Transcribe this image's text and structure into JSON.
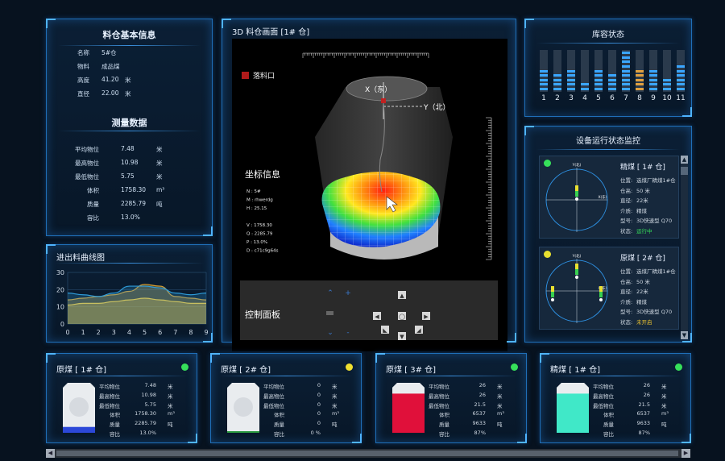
{
  "info": {
    "title": "料仓基本信息",
    "rows": [
      {
        "k": "名称",
        "v": "5#仓",
        "u": ""
      },
      {
        "k": "物料",
        "v": "成品煤",
        "u": ""
      },
      {
        "k": "高度",
        "v": "41.20",
        "u": "米"
      },
      {
        "k": "直径",
        "v": "22.00",
        "u": "米"
      }
    ],
    "measure_title": "测量数据",
    "measure": [
      {
        "k": "平均物位",
        "v": "7.48",
        "u": "米"
      },
      {
        "k": "最高物位",
        "v": "10.98",
        "u": "米"
      },
      {
        "k": "最低物位",
        "v": "5.75",
        "u": "米"
      },
      {
        "k": "体积",
        "v": "1758.30",
        "u": "m³"
      },
      {
        "k": "质量",
        "v": "2285.79",
        "u": "吨"
      },
      {
        "k": "容比",
        "v": "13.0%",
        "u": ""
      }
    ]
  },
  "curve": {
    "title": "进出料曲线图",
    "chart_data": {
      "type": "area",
      "x": [
        0,
        1,
        2,
        3,
        4,
        5,
        6,
        7,
        8,
        9
      ],
      "series": [
        {
          "values": [
            14,
            15,
            16,
            17,
            19,
            23,
            22,
            16,
            15,
            14
          ],
          "color": "#d8a032"
        },
        {
          "values": [
            18,
            17,
            16,
            18,
            22,
            22,
            21,
            18,
            17,
            18
          ],
          "color": "#2e9bd8"
        },
        {
          "values": [
            11,
            12,
            12,
            13,
            14,
            15,
            14,
            13,
            12,
            12
          ],
          "color": "#c8c060"
        }
      ],
      "xlabel": "",
      "ylabel": "",
      "ylim": [
        0,
        30
      ],
      "yticks": [
        "30",
        "20",
        "10",
        "0"
      ],
      "xticks": [
        "0",
        "1",
        "2",
        "3",
        "4",
        "5",
        "6",
        "7",
        "8",
        "9"
      ]
    }
  },
  "view3d": {
    "title": "3D 料仓画面 [1# 仓]",
    "legend": "落料口",
    "axis_x": "X（东）",
    "axis_y": "Y（北）",
    "coord_title": "坐标信息",
    "coord_lines": [
      "N : 5#",
      "M : rhwerdg",
      "H : 25.15",
      "",
      "V : 1758.30",
      "Q : 2285.79",
      "P : 13.0%",
      "D : c71c9g64s"
    ],
    "control_title": "控制面板"
  },
  "capacity": {
    "title": "库容状态",
    "bins": [
      {
        "label": "1",
        "fill": 0.5,
        "color": "#3aa6ff"
      },
      {
        "label": "2",
        "fill": 0.4,
        "color": "#3aa6ff"
      },
      {
        "label": "3",
        "fill": 0.55,
        "color": "#3aa6ff"
      },
      {
        "label": "4",
        "fill": 0.2,
        "color": "#3aa6ff"
      },
      {
        "label": "5",
        "fill": 0.5,
        "color": "#3aa6ff"
      },
      {
        "label": "6",
        "fill": 0.45,
        "color": "#3aa6ff"
      },
      {
        "label": "7",
        "fill": 0.95,
        "color": "#3aa6ff"
      },
      {
        "label": "8",
        "fill": 0.6,
        "color": "#e0a040"
      },
      {
        "label": "9",
        "fill": 0.6,
        "color": "#3aa6ff"
      },
      {
        "label": "10",
        "fill": 0.35,
        "color": "#3aa6ff"
      },
      {
        "label": "11",
        "fill": 0.7,
        "color": "#3aa6ff"
      }
    ]
  },
  "monitor": {
    "title": "设备运行状态监控",
    "cards": [
      {
        "name": "精煤 [ 1# 仓]",
        "dot": "#36e05a",
        "y_label": "Y(北)",
        "x_label": "X(东)",
        "rows": [
          {
            "k": "位置:",
            "v": "选煤厂精煤1#仓"
          },
          {
            "k": "仓高:",
            "v": "50 米"
          },
          {
            "k": "直径:",
            "v": "22米"
          },
          {
            "k": "介质:",
            "v": "精煤"
          },
          {
            "k": "型号:",
            "v": "3D快速型 Q70"
          },
          {
            "k": "状态:",
            "v": "运行中"
          }
        ],
        "status_color": "#36e05a"
      },
      {
        "name": "原煤 [ 2# 仓]",
        "dot": "#e8e030",
        "y_label": "Y(北)",
        "x_label": "X(东)",
        "rows": [
          {
            "k": "位置:",
            "v": "选煤厂精煤1#仓"
          },
          {
            "k": "仓高:",
            "v": "50 米"
          },
          {
            "k": "直径:",
            "v": "22米"
          },
          {
            "k": "介质:",
            "v": "精煤"
          },
          {
            "k": "型号:",
            "v": "3D快速型 Q70"
          },
          {
            "k": "状态:",
            "v": "未开启"
          }
        ],
        "status_color": "#e8c030"
      }
    ]
  },
  "silos": [
    {
      "title": "原煤 [ 1# 仓]",
      "dot": "#36e05a",
      "fill": 0.13,
      "fill_color": "#2c48d8",
      "rows": [
        {
          "k": "平均物位",
          "v": "7.48",
          "u": "米"
        },
        {
          "k": "最高物位",
          "v": "10.98",
          "u": "米"
        },
        {
          "k": "最低物位",
          "v": "5.75",
          "u": "米"
        },
        {
          "k": "体积",
          "v": "1758.30",
          "u": "m³"
        },
        {
          "k": "质量",
          "v": "2285.79",
          "u": "吨"
        },
        {
          "k": "容比",
          "v": "13.0%",
          "u": ""
        }
      ]
    },
    {
      "title": "原煤 [ 2# 仓]",
      "dot": "#f0e030",
      "fill": 0.0,
      "fill_color": "#2a9a40",
      "rows": [
        {
          "k": "平均物位",
          "v": "0",
          "u": "米"
        },
        {
          "k": "最高物位",
          "v": "0",
          "u": "米"
        },
        {
          "k": "最低物位",
          "v": "0",
          "u": "米"
        },
        {
          "k": "体积",
          "v": "0",
          "u": "m³"
        },
        {
          "k": "质量",
          "v": "0",
          "u": "吨"
        },
        {
          "k": "容比",
          "v": "0 %",
          "u": ""
        }
      ]
    },
    {
      "title": "原煤 [ 3# 仓]",
      "dot": "#36e05a",
      "fill": 0.87,
      "fill_color": "#e0103a",
      "rows": [
        {
          "k": "平均物位",
          "v": "26",
          "u": "米"
        },
        {
          "k": "最高物位",
          "v": "26",
          "u": "米"
        },
        {
          "k": "最低物位",
          "v": "21.5",
          "u": "米"
        },
        {
          "k": "体积",
          "v": "6537",
          "u": "m³"
        },
        {
          "k": "质量",
          "v": "9633",
          "u": "吨"
        },
        {
          "k": "容比",
          "v": "87%",
          "u": ""
        }
      ]
    },
    {
      "title": "精煤 [ 1# 仓]",
      "dot": "#36e05a",
      "fill": 0.87,
      "fill_color": "#40e8c8",
      "rows": [
        {
          "k": "平均物位",
          "v": "26",
          "u": "米"
        },
        {
          "k": "最高物位",
          "v": "26",
          "u": "米"
        },
        {
          "k": "最低物位",
          "v": "21.5",
          "u": "米"
        },
        {
          "k": "体积",
          "v": "6537",
          "u": "m³"
        },
        {
          "k": "质量",
          "v": "9633",
          "u": "吨"
        },
        {
          "k": "容比",
          "v": "87%",
          "u": ""
        }
      ]
    }
  ]
}
